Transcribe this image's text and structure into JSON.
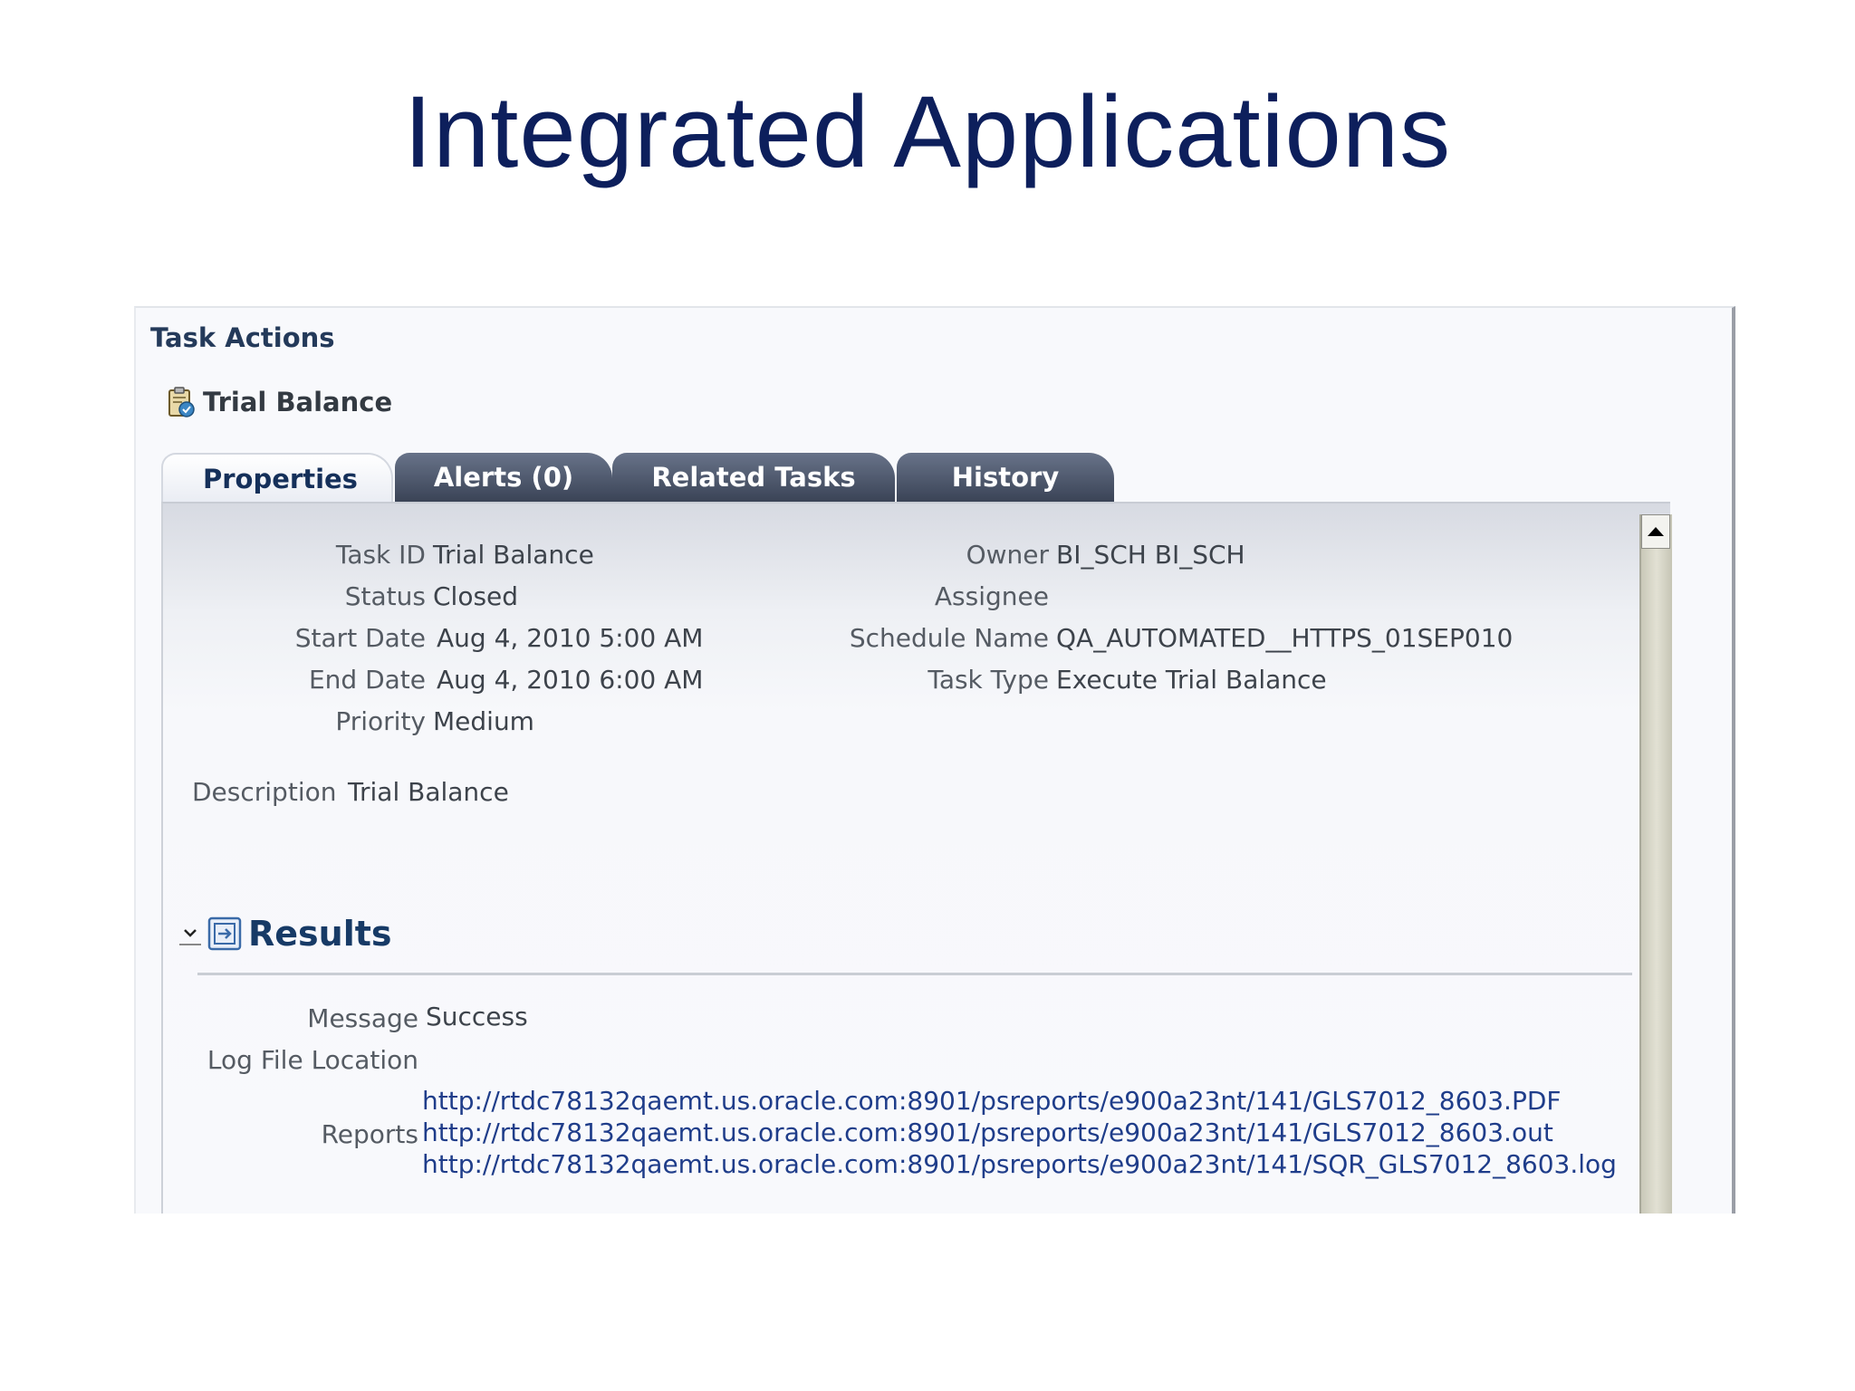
{
  "slide": {
    "title": "Integrated Applications"
  },
  "header": {
    "section_title": "Task Actions",
    "task_name": "Trial Balance"
  },
  "tabs": [
    {
      "label": "Properties",
      "active": true
    },
    {
      "label": "Alerts (0)",
      "active": false
    },
    {
      "label": "Related Tasks",
      "active": false
    },
    {
      "label": "History",
      "active": false
    }
  ],
  "properties": {
    "task_id": {
      "label": "Task ID",
      "value": "Trial Balance"
    },
    "status": {
      "label": "Status",
      "value": "Closed"
    },
    "start_date": {
      "label": "Start Date",
      "value": "Aug 4, 2010 5:00 AM"
    },
    "end_date": {
      "label": "End Date",
      "value": "Aug 4, 2010 6:00 AM"
    },
    "priority": {
      "label": "Priority",
      "value": "Medium"
    },
    "owner": {
      "label": "Owner",
      "value": "BI_SCH BI_SCH"
    },
    "assignee": {
      "label": "Assignee",
      "value": ""
    },
    "schedule_name": {
      "label": "Schedule Name",
      "value": "QA_AUTOMATED__HTTPS_01SEP010"
    },
    "task_type": {
      "label": "Task Type",
      "value": "Execute Trial Balance"
    },
    "description": {
      "label": "Description",
      "value": "Trial Balance"
    }
  },
  "results": {
    "title": "Results",
    "message": {
      "label": "Message",
      "value": "Success"
    },
    "log_file_location": {
      "label": "Log File Location",
      "value": ""
    },
    "reports": {
      "label": "Reports",
      "links": [
        "http://rtdc78132qaemt.us.oracle.com:8901/psreports/e900a23nt/141/GLS7012_8603.PDF",
        "http://rtdc78132qaemt.us.oracle.com:8901/psreports/e900a23nt/141/GLS7012_8603.out",
        "http://rtdc78132qaemt.us.oracle.com:8901/psreports/e900a23nt/141/SQR_GLS7012_8603.log"
      ]
    }
  },
  "icons": {
    "task": "clipboard-task-icon",
    "results_toggle": "chevron-down-icon",
    "results": "results-section-icon",
    "scroll_up": "scroll-up-arrow-icon"
  },
  "colors": {
    "title": "#0d1f5c",
    "tab_inactive": "#3a4356",
    "link": "#1f3d8a",
    "heading": "#173a66"
  }
}
